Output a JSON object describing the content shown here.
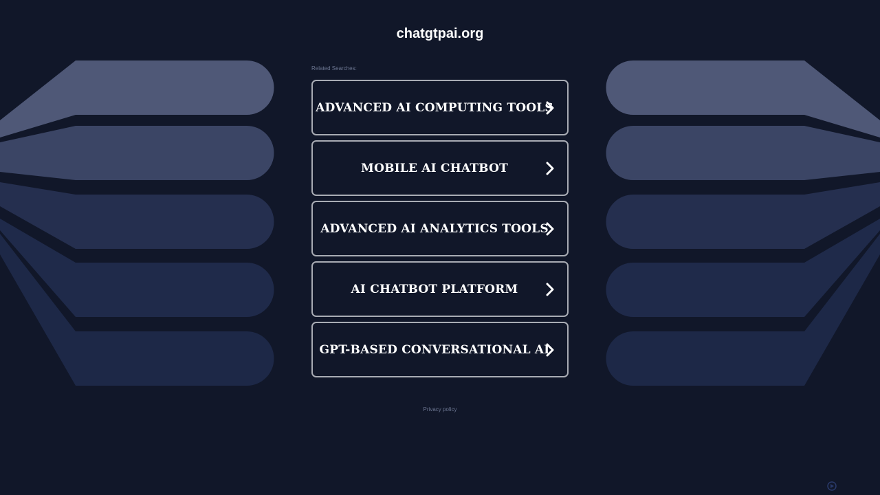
{
  "header": {
    "site_title": "chatgtpai.org"
  },
  "related": {
    "label": "Related Searches:"
  },
  "results": [
    {
      "label": "ADVANCED AI COMPUTING TOOLS"
    },
    {
      "label": "MOBILE AI CHATBOT"
    },
    {
      "label": "ADVANCED AI ANALYTICS TOOLS"
    },
    {
      "label": "AI CHATBOT PLATFORM"
    },
    {
      "label": "GPT-BASED CONVERSATIONAL AI"
    }
  ],
  "footer": {
    "privacy_label": "Privacy policy"
  },
  "icons": {
    "result_arrow": "chevron-right-icon",
    "corner": "ad-choices-icon"
  },
  "colors": {
    "background": "#111729",
    "button_border": "#a9acb4",
    "text": "#ffffff",
    "muted_text": "#6b7590"
  }
}
